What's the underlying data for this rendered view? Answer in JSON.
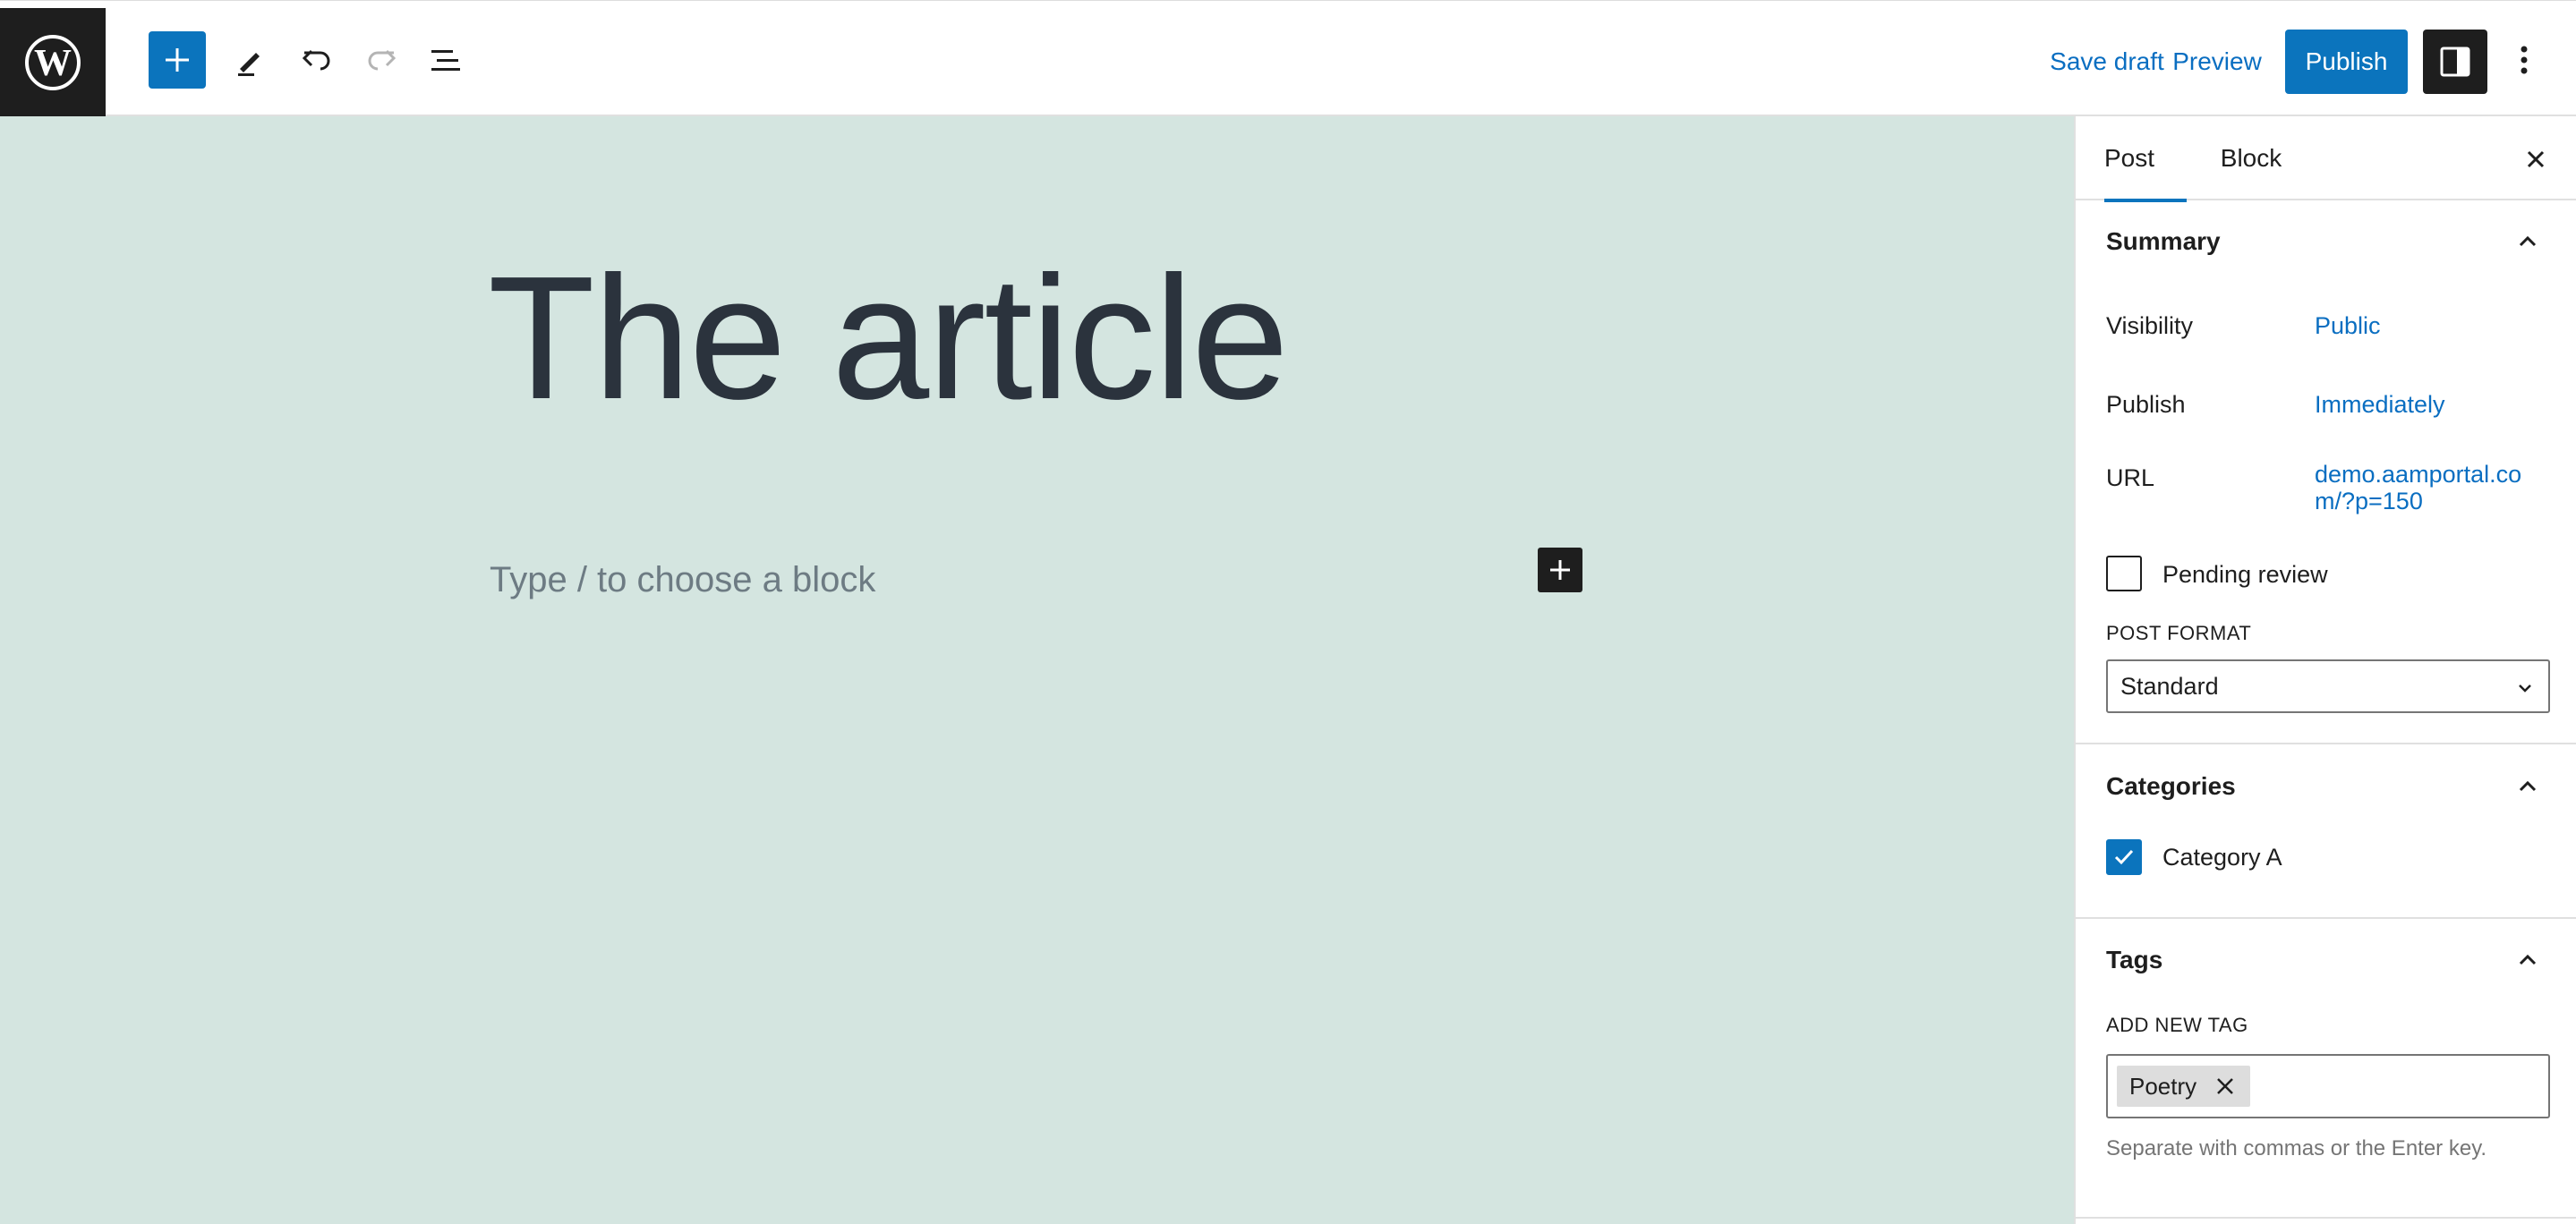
{
  "toolbar": {
    "save_draft_label": "Save draft",
    "preview_label": "Preview",
    "publish_label": "Publish"
  },
  "editor": {
    "post_title": "The article",
    "block_placeholder": "Type / to choose a block"
  },
  "sidebar": {
    "tabs": [
      {
        "label": "Post",
        "active": true
      },
      {
        "label": "Block",
        "active": false
      }
    ],
    "summary": {
      "heading": "Summary",
      "visibility_label": "Visibility",
      "visibility_value": "Public",
      "publish_label": "Publish",
      "publish_value": "Immediately",
      "url_label": "URL",
      "url_value": "demo.aamportal.com/?p=150",
      "pending_review_label": "Pending review",
      "pending_review_checked": false,
      "post_format_label": "POST FORMAT",
      "post_format_value": "Standard"
    },
    "categories": {
      "heading": "Categories",
      "items": [
        {
          "label": "Category A",
          "checked": true
        }
      ]
    },
    "tags": {
      "heading": "Tags",
      "add_new_label": "ADD NEW TAG",
      "chips": [
        "Poetry"
      ],
      "help": "Separate with commas or the Enter key."
    }
  },
  "colors": {
    "accent": "#0b74bd",
    "canvas_bg": "#d4e5e0",
    "dark": "#1e1e1e"
  }
}
